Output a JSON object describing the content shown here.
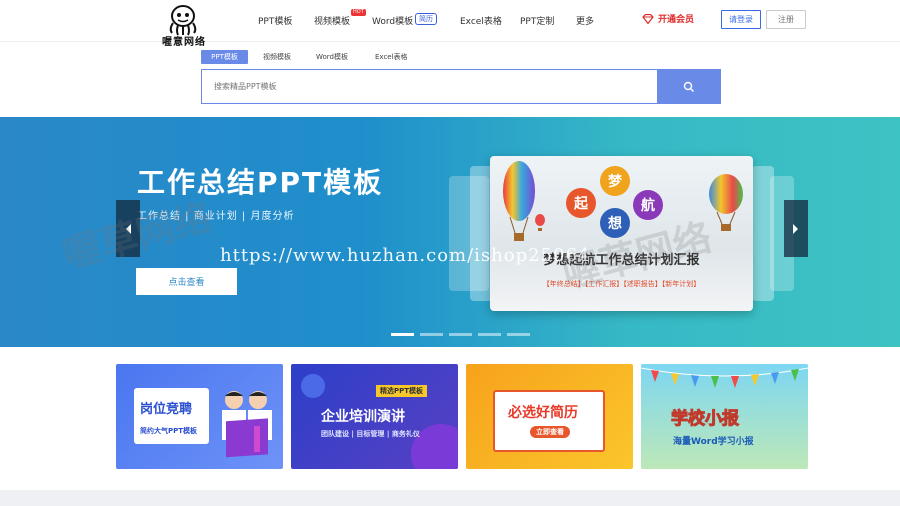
{
  "header": {
    "logo_text": "喔意网络",
    "nav": [
      {
        "label": "PPT模板"
      },
      {
        "label": "视频模板"
      },
      {
        "label": "Word模板"
      },
      {
        "label": "Excel表格"
      },
      {
        "label": "PPT定制"
      },
      {
        "label": "更多"
      }
    ],
    "hot_badge": "HOT",
    "new_badge": "简历",
    "vip_label": "开通会员",
    "login_label": "请登录",
    "register_label": "注册"
  },
  "search": {
    "tabs": [
      "PPT模板",
      "视频模板",
      "Word模板",
      "Excel表格"
    ],
    "active_tab": "PPT模板",
    "placeholder": "搜索精品PPT模板"
  },
  "banner": {
    "title": "工作总结PPT模板",
    "subtitle": "工作总结 | 商业计划 | 月度分析",
    "cta": "点击查看",
    "card_title": "梦想起航工作总结计划汇报",
    "card_tags": "【年终总结】【工作汇报】【述职报告】【新年计划】",
    "card_words": [
      "梦",
      "起",
      "想",
      "航"
    ],
    "watermark_url": "https://www.huzhan.com/ishop25064",
    "slides": 5,
    "active_slide": 1
  },
  "promos": [
    {
      "title": "岗位竞聘",
      "sub": "简约大气PPT模板"
    },
    {
      "title": "企业培训演讲",
      "badge": "精选PPT模板",
      "sub": "团队建设 | 目标管理 | 商务礼仪"
    },
    {
      "title": "必选好简历",
      "sub": "立即查看"
    },
    {
      "title": "学校小报",
      "sub": "海量Word学习小报"
    }
  ],
  "watermarks": [
    "喔草网络",
    "喔草网络"
  ],
  "colors": {
    "accent": "#6a8ae8",
    "vip": "#e02b2b",
    "banner": "#2a88c8"
  }
}
